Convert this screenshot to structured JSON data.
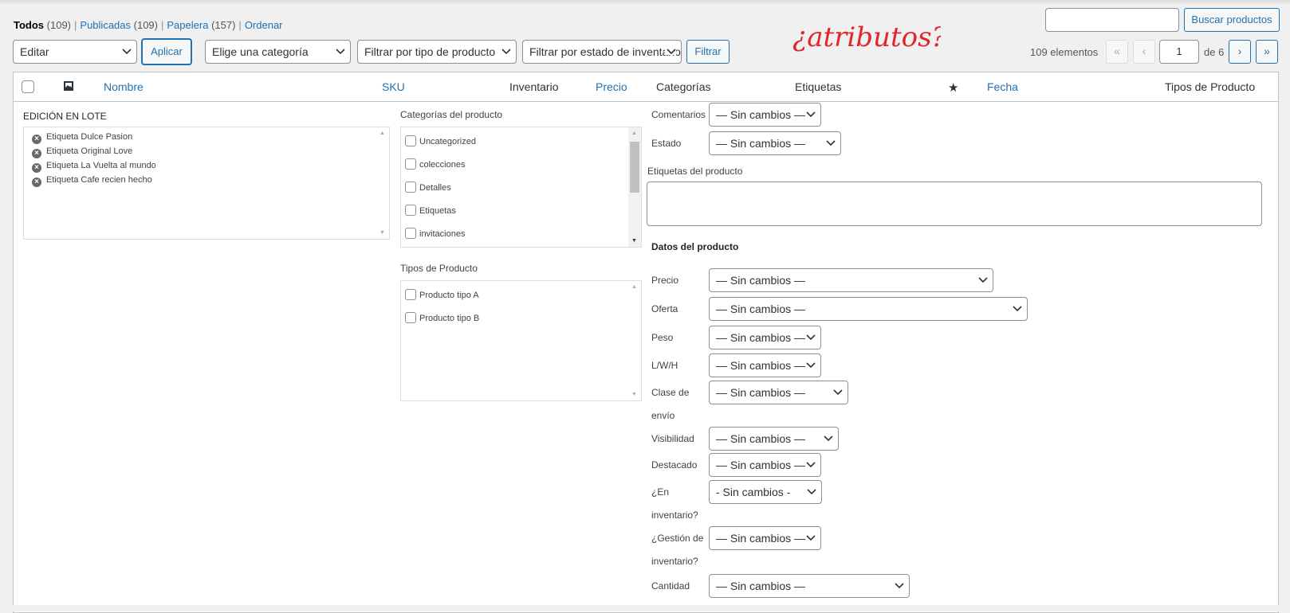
{
  "views": {
    "all_label": "Todos",
    "all_count": "(109)",
    "published_label": "Publicadas",
    "published_count": "(109)",
    "trash_label": "Papelera",
    "trash_count": "(157)",
    "sort_label": "Ordenar"
  },
  "search": {
    "value": "",
    "button": "Buscar productos"
  },
  "toolbar": {
    "bulk_action": "Editar",
    "apply": "Aplicar",
    "category_filter": "Elige una categoría",
    "type_filter": "Filtrar por tipo de producto",
    "stock_filter": "Filtrar por estado de inventario",
    "filter_button": "Filtrar"
  },
  "annotation": "¿atributos?",
  "pagination": {
    "items": "109 elementos",
    "first": "«",
    "prev": "‹",
    "current_page": "1",
    "of_pages": "de 6",
    "next": "›",
    "last": "»"
  },
  "columns": {
    "name": "Nombre",
    "sku": "SKU",
    "stock": "Inventario",
    "price": "Precio",
    "categories": "Categorías",
    "tags": "Etiquetas",
    "date": "Fecha",
    "product_types": "Tipos de Producto"
  },
  "bulk_edit": {
    "title": "EDICIÓN EN LOTE",
    "items": [
      "Etiqueta Dulce Pasion",
      "Etiqueta Original Love",
      "Etiqueta La Vuelta al mundo",
      "Etiqueta Cafe recien hecho"
    ],
    "categories_title": "Categorías del producto",
    "categories": [
      "Uncategorized",
      "colecciones",
      "Detalles",
      "Etiquetas",
      "invitaciones"
    ],
    "types_title": "Tipos de Producto",
    "types": [
      "Producto tipo A",
      "Producto tipo B"
    ],
    "comments_label": "Comentarios",
    "comments_value": "— Sin cambios —",
    "status_label": "Estado",
    "status_value": "— Sin cambios —",
    "tags_label": "Etiquetas del producto",
    "product_data_title": "Datos del producto",
    "fields": [
      {
        "label": "Precio",
        "value": "— Sin cambios —"
      },
      {
        "label": "Oferta",
        "value": "— Sin cambios —"
      },
      {
        "label": "Peso",
        "value": "— Sin cambios —"
      },
      {
        "label": "L/W/H",
        "value": "— Sin cambios —"
      },
      {
        "label1": "Clase de",
        "label2": "envío",
        "value": "— Sin cambios —"
      },
      {
        "label": "Visibilidad",
        "value": "— Sin cambios —"
      },
      {
        "label": "Destacado",
        "value": "— Sin cambios —"
      },
      {
        "label1": "¿En",
        "label2": "inventario?",
        "value": "- Sin cambios -"
      },
      {
        "label1": "¿Gestión de",
        "label2": "inventario?",
        "value": "— Sin cambios —"
      },
      {
        "label": "Cantidad",
        "value": "— Sin cambios —"
      }
    ]
  }
}
